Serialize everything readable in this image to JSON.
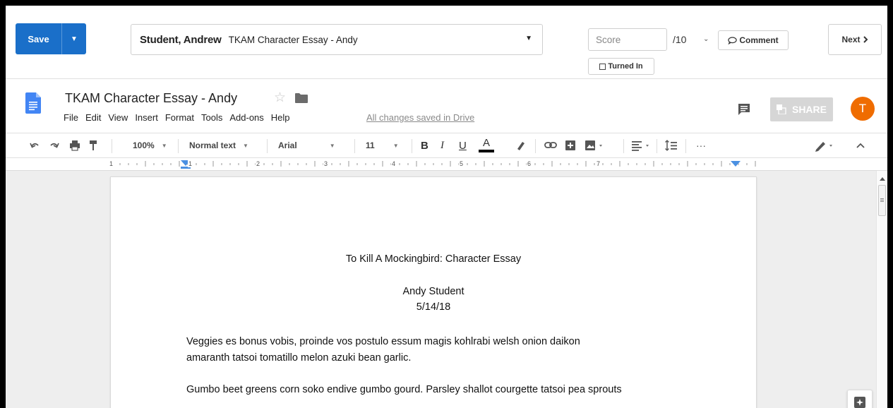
{
  "grading": {
    "save_label": "Save",
    "save_caret": "▼",
    "student_name": "Student, Andrew",
    "assignment": "TKAM Character Essay - Andy",
    "select_caret": "▼",
    "score_placeholder": "Score",
    "score_total": "/10",
    "score_caret": "⌄",
    "comment_label": "Comment",
    "turned_in_label": "Turned In",
    "next_label": "Next",
    "next_icon": "›"
  },
  "doc": {
    "title": "TKAM Character Essay - Andy",
    "star_icon": "☆",
    "menu": [
      "File",
      "Edit",
      "View",
      "Insert",
      "Format",
      "Tools",
      "Add-ons",
      "Help"
    ],
    "saved_status": "All changes saved in Drive",
    "share_label": "SHARE",
    "avatar_initial": "T"
  },
  "toolbar": {
    "zoom": "100%",
    "style": "Normal text",
    "font": "Arial",
    "size": "11",
    "bold": "B",
    "italic": "I",
    "underline": "U",
    "text_color": "A",
    "more": "···"
  },
  "ruler": {
    "numbers": [
      "1",
      "1",
      "2",
      "3",
      "4",
      "5",
      "6",
      "7"
    ]
  },
  "page": {
    "heading": "To Kill A Mockingbird: Character Essay",
    "author": "Andy Student",
    "date": "5/14/18",
    "para1_line1": "Veggies es bonus vobis, proinde vos postulo essum magis kohlrabi welsh onion daikon",
    "para1_line2": "amaranth tatsoi tomatillo melon azuki bean garlic.",
    "para2_line1": "Gumbo beet greens corn soko endive gumbo gourd. Parsley shallot courgette tatsoi pea sprouts"
  },
  "colors": {
    "save_blue": "#1a6fc9",
    "avatar_orange": "#ef6c00",
    "docs_blue": "#4285f4",
    "ruler_marker": "#4a90e2"
  }
}
